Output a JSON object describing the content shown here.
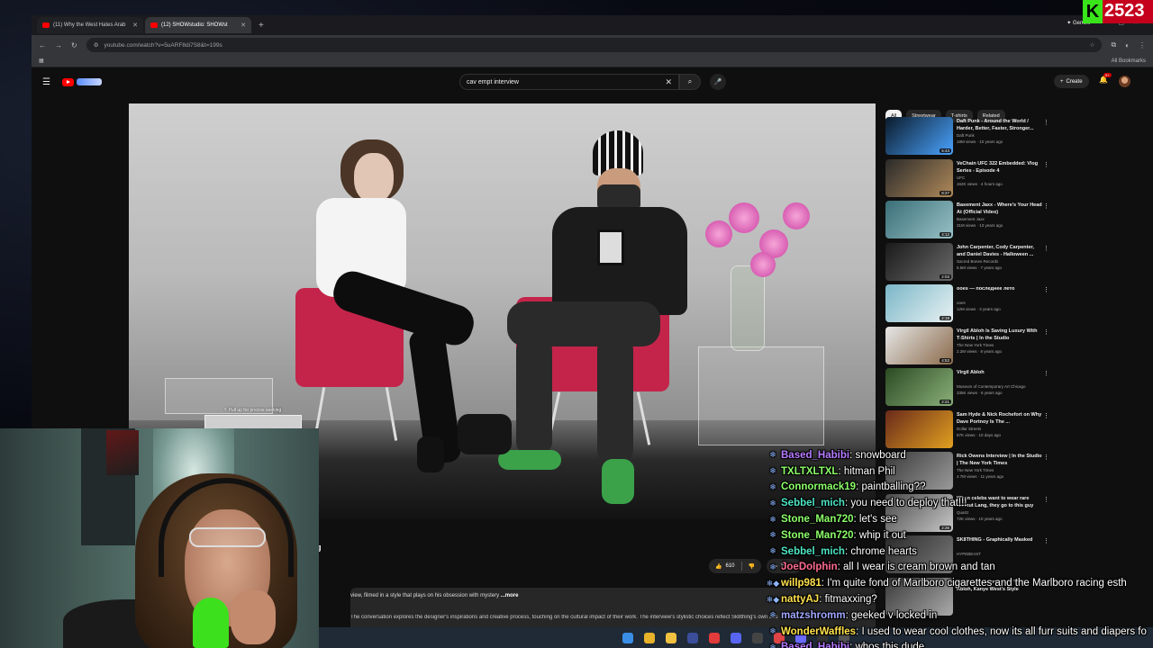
{
  "browser": {
    "tabs": [
      {
        "title": "(11) Why the West Hates Arab",
        "active": false
      },
      {
        "title": "(12) SHOWstudio: SHOWst",
        "active": true
      }
    ],
    "gemini_label": "Gemini",
    "url": "youtube.com/watch?v=5uARF8di7S8&t=199s",
    "all_bookmarks": "All Bookmarks"
  },
  "youtube": {
    "search_value": "cav empt interview",
    "create_label": "Create",
    "notif_count": "9+",
    "player": {
      "seek_hint": "Pull up for precise seeking"
    },
    "title_fragment": "g",
    "like_count": "610",
    "share_label": "Share",
    "description": {
      "line1": "view, filmed in a style that plays on his obsession with mystery",
      "more": "...more",
      "line2": "The conversation explores the designer's inspirations and creative process, touching on the cultural impact of their work. The interview's stylistic choices reflect Sk8thing's own aes"
    },
    "chips": [
      "All",
      "Streetwear",
      "T-shirts",
      "Related"
    ],
    "recommendations": [
      {
        "title": "Daft Punk - Around the World / Harder, Better, Faster, Stronger...",
        "channel": "Daft Punk",
        "views": "18M views · 10 years ago",
        "duration": "5:43",
        "colors": [
          "#0a1a2a",
          "#4aa3ff"
        ]
      },
      {
        "title": "VeChain UFC 322 Embedded: Vlog Series - Episode 4",
        "channel": "UFC",
        "views": "162K views · 4 hours ago",
        "duration": "8:27",
        "colors": [
          "#2a2a2a",
          "#b08a5a"
        ]
      },
      {
        "title": "Basement Jaxx - Where's Your Head At (Official Video)",
        "channel": "Basement Jaxx",
        "views": "31M views · 13 years ago",
        "duration": "4:12",
        "colors": [
          "#3a6e77",
          "#98c2c6"
        ]
      },
      {
        "title": "John Carpenter, Cody Carpenter, and Daniel Davies - Halloween ...",
        "channel": "Sacred Bones Records",
        "views": "5.5M views · 7 years ago",
        "duration": "2:03",
        "colors": [
          "#1a1a1a",
          "#6a6a6a"
        ]
      },
      {
        "title": "ooes — последнее лето",
        "channel": "ooes",
        "views": "12M views · 4 years ago",
        "duration": "2:18",
        "colors": [
          "#7ab6c8",
          "#e9f2f2"
        ]
      },
      {
        "title": "Virgil Abloh Is Saving Luxury With T-Shirts | In the Studio",
        "channel": "The New York Times",
        "views": "2.2M views · 8 years ago",
        "duration": "4:53",
        "colors": [
          "#e6e6e6",
          "#8a6a4a"
        ]
      },
      {
        "title": "Virgil Abloh",
        "channel": "Museum of Contemporary Art Chicago",
        "views": "335K views · 6 years ago",
        "duration": "2:21",
        "colors": [
          "#2b4a22",
          "#8ab07a"
        ]
      },
      {
        "title": "Sam Hyde & Nick Rochefort on Why Dave Portnoy Is The ...",
        "channel": "Dollar Streets",
        "views": "57K views · 10 days ago",
        "duration": "",
        "colors": [
          "#6a2a1a",
          "#e0a020"
        ]
      },
      {
        "title": "Rick Owens Interview | In the Studio | The New York Times",
        "channel": "The New York Times",
        "views": "4.7M views · 11 years ago",
        "duration": "",
        "colors": [
          "#3a3a3a",
          "#9a9a9a"
        ]
      },
      {
        "title": "When celebs want to wear rare Helmut Lang, they go to this guy",
        "channel": "Quartz",
        "views": "72K views · 10 years ago",
        "duration": "2:26",
        "colors": [
          "#4a4a4a",
          "#c8c8c8"
        ]
      },
      {
        "title": "SK8THING - Graphically Masked",
        "channel": "HYPEBEAST",
        "views": "",
        "duration": "",
        "colors": [
          "#2a2a2a",
          "#7a7a7a"
        ]
      },
      {
        "title": "Behind the Scenes with Virgil Abloh, Kanye West's Style",
        "channel": "",
        "views": "",
        "duration": "",
        "colors": [
          "#3a3a3a",
          "#aaaaaa"
        ]
      }
    ]
  },
  "chat": [
    {
      "user": "Based_Habibi",
      "text": "snowboard",
      "color": "#b67bff",
      "badge": "snowflake"
    },
    {
      "user": "TXLTXLTXL",
      "text": "hitman Phil",
      "color": "#8dff6a",
      "badge": "snowflake"
    },
    {
      "user": "Connormack19",
      "text": "paintballing??",
      "color": "#8dff6a",
      "badge": "snowflake"
    },
    {
      "user": "Sebbel_mich",
      "text": "you need to deploy that!!!",
      "color": "#4de4c4",
      "badge": "snowflake"
    },
    {
      "user": "Stone_Man720",
      "text": "let's see",
      "color": "#8dff6a",
      "badge": "snowflake"
    },
    {
      "user": "Stone_Man720",
      "text": "whip it out",
      "color": "#8dff6a",
      "badge": "snowflake"
    },
    {
      "user": "Sebbel_mich",
      "text": "chrome hearts",
      "color": "#4de4c4",
      "badge": "snowflake"
    },
    {
      "user": "JoeDolphin",
      "text": "all I wear is cream brown and tan",
      "color": "#ff6b8f",
      "badge": "snowflake"
    },
    {
      "user": "willp981",
      "text": "I'm quite fond of Marlboro cigarettes and the Marlboro racing esth",
      "color": "#ffe14d",
      "badge": "snowflake-cube"
    },
    {
      "user": "nattyAJ",
      "text": "fitmaxxing?",
      "color": "#ffe14d",
      "badge": "snowflake-cube"
    },
    {
      "user": "matzshromm",
      "text": "geeked v locked in",
      "color": "#9fa8ff",
      "badge": "snowflake"
    },
    {
      "user": "WonderWaffles",
      "text": "I used to wear cool clothes, now its all furr suits and diapers fo",
      "color": "#ffe14d",
      "badge": "snowflake"
    },
    {
      "user": "Based_Habibi",
      "text": "whos this dude",
      "color": "#b67bff",
      "badge": "snowflake"
    }
  ],
  "overlay_badge": {
    "letter": "K",
    "number": "2523"
  },
  "taskbar_icons": [
    "windows-start-icon",
    "chrome-icon",
    "file-explorer-icon",
    "obs-icon",
    "steam-icon",
    "discord-icon",
    "app-icon",
    "app-icon-2",
    "app-icon-3",
    "app-icon-4",
    "app-icon-5"
  ]
}
